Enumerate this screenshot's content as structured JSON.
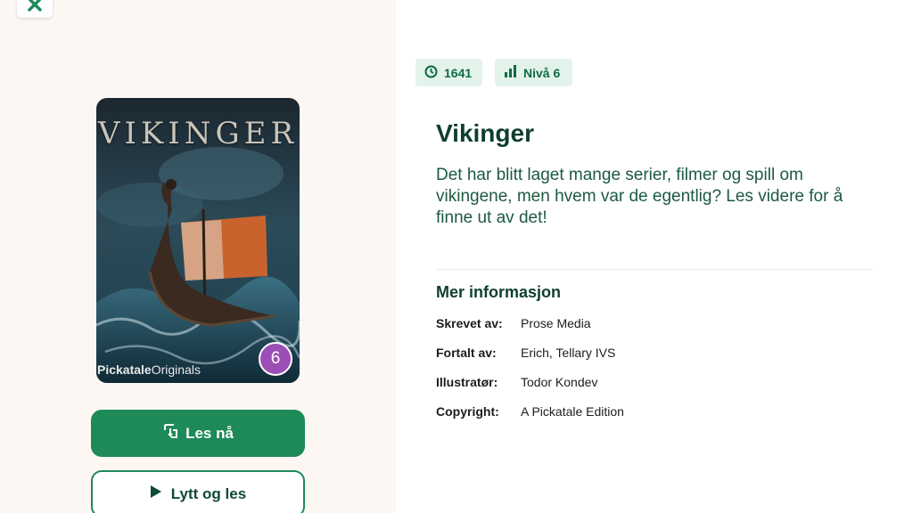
{
  "cover": {
    "title": "VIKINGER",
    "brand_bold": "Pickatale",
    "brand_regular": "Originals",
    "level_badge": "6"
  },
  "actions": {
    "read_now": "Les nå",
    "listen_and_read": "Lytt og les"
  },
  "meta": {
    "duration": "1641",
    "level": "Nivå 6"
  },
  "book": {
    "title": "Vikinger",
    "description": "Det har blitt laget mange serier, filmer og spill om vikingene, men hvem var de egentlig? Les videre for å finne ut av det!"
  },
  "more_info": {
    "heading": "Mer informasjon",
    "rows": [
      {
        "key": "Skrevet av:",
        "value": "Prose Media"
      },
      {
        "key": "Fortalt av:",
        "value": "Erich, Tellary IVS"
      },
      {
        "key": "Illustratør:",
        "value": "Todor Kondev"
      },
      {
        "key": "Copyright:",
        "value": "A Pickatale Edition"
      }
    ]
  },
  "colors": {
    "accent": "#1e8a58",
    "dark_green": "#0e3f2c",
    "chip_bg": "#e3f3ec",
    "level_badge": "#9b4fb6",
    "left_panel_bg": "#fdf7f4"
  },
  "icons": {
    "close": "close-icon",
    "clock": "clock-icon",
    "level": "bar-chart-icon",
    "read": "tap-book-icon",
    "play": "play-icon"
  }
}
